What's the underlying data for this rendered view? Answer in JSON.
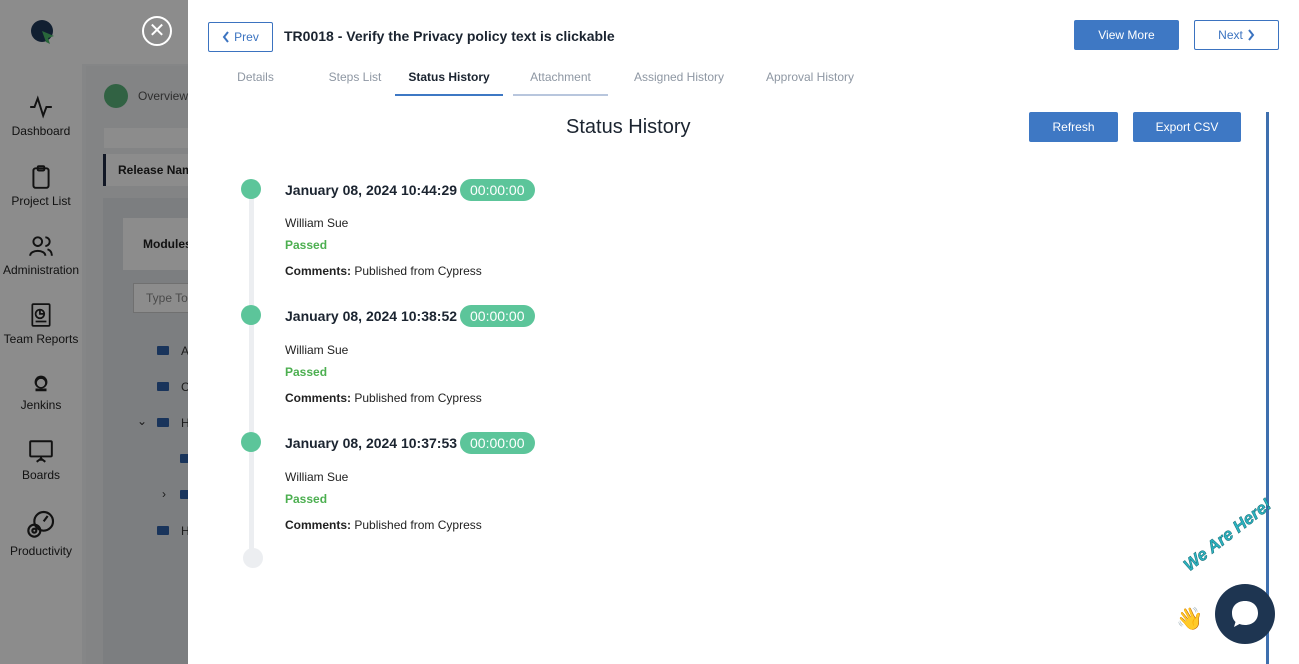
{
  "sidebar": {
    "items": [
      {
        "label": "Dashboard",
        "icon": "activity-icon"
      },
      {
        "label": "Project List",
        "icon": "clipboard-icon"
      },
      {
        "label": "Administration",
        "icon": "users-icon"
      },
      {
        "label": "Team Reports",
        "icon": "report-icon"
      },
      {
        "label": "Jenkins",
        "icon": "jenkins-icon"
      },
      {
        "label": "Boards",
        "icon": "board-icon"
      },
      {
        "label": "Productivity",
        "icon": "productivity-icon"
      }
    ]
  },
  "background": {
    "breadcrumb": "Overview",
    "release_label": "Release Nam",
    "modules_label": "Modules",
    "search_placeholder": "Type To",
    "tree_letters": [
      "A",
      "C",
      "H",
      "H"
    ]
  },
  "modal": {
    "prev_label": "Prev",
    "next_label": "Next",
    "title": "TR0018 - Verify the Privacy policy text is clickable",
    "view_more_label": "View More",
    "tabs": [
      {
        "label": "Details"
      },
      {
        "label": "Steps List"
      },
      {
        "label": "Status History"
      },
      {
        "label": "Attachment"
      },
      {
        "label": "Assigned History"
      },
      {
        "label": "Approval History"
      }
    ],
    "section_title": "Status History",
    "refresh_label": "Refresh",
    "export_label": "Export CSV",
    "entries": [
      {
        "date": "January 08, 2024 10:44:29",
        "duration": "00:00:00",
        "user": "William Sue",
        "status": "Passed",
        "comment_label": "Comments:",
        "comment": "Published from Cypress"
      },
      {
        "date": "January 08, 2024 10:38:52",
        "duration": "00:00:00",
        "user": "William Sue",
        "status": "Passed",
        "comment_label": "Comments:",
        "comment": "Published from Cypress"
      },
      {
        "date": "January 08, 2024 10:37:53",
        "duration": "00:00:00",
        "user": "William Sue",
        "status": "Passed",
        "comment_label": "Comments:",
        "comment": "Published from Cypress"
      }
    ]
  },
  "chat": {
    "tagline": "We Are Here!"
  },
  "colors": {
    "accent": "#3e78c4",
    "success": "#5cc59a",
    "passed": "#4caf50"
  }
}
